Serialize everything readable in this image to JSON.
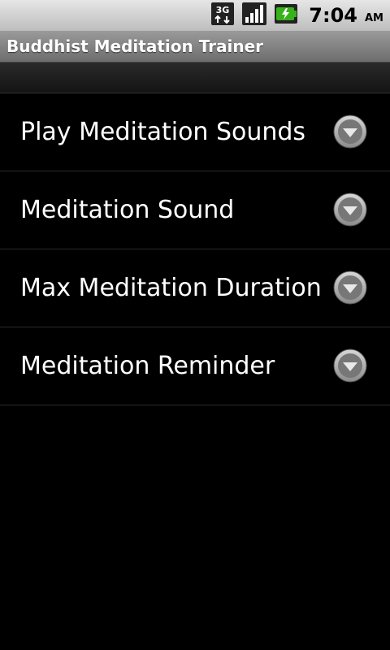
{
  "status_bar": {
    "time": "7:04",
    "ampm": "AM",
    "icons": [
      "3g-data-icon",
      "signal-bars-icon",
      "battery-charging-icon"
    ]
  },
  "app": {
    "title": "Buddhist Meditation Trainer"
  },
  "preferences": {
    "items": [
      {
        "label": "Play Meditation Sounds",
        "icon": "chevron-down-icon"
      },
      {
        "label": "Meditation Sound",
        "icon": "chevron-down-icon"
      },
      {
        "label": "Max Meditation Duration",
        "icon": "chevron-down-icon"
      },
      {
        "label": "Meditation Reminder",
        "icon": "chevron-down-icon"
      }
    ]
  },
  "colors": {
    "background": "#000000",
    "text": "#ffffff",
    "title_bar": "#7a7a7a",
    "status_bar": "#d0d0d0",
    "battery_accent": "#37b21a"
  }
}
